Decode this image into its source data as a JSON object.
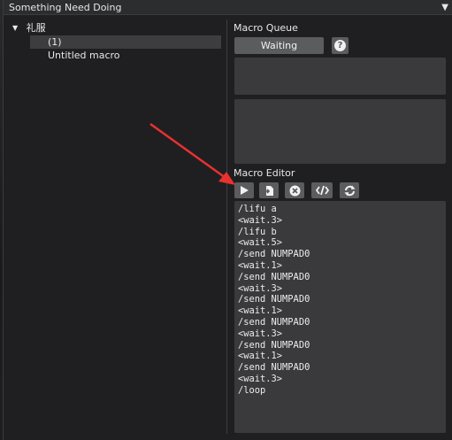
{
  "window": {
    "title": "Something Need Doing",
    "collapse_icon": "triangle-down-icon"
  },
  "tree": {
    "folder_label": "礼服",
    "items": [
      {
        "label": "(1)",
        "selected": true
      },
      {
        "label": "Untitled macro",
        "selected": false
      }
    ]
  },
  "queue": {
    "title": "Macro Queue",
    "status_button": "Waiting",
    "help_icon": "?"
  },
  "editor": {
    "title": "Macro Editor",
    "toolbar": [
      "play-icon",
      "import-icon",
      "close-circle-icon",
      "code-icon",
      "refresh-icon"
    ],
    "lines": [
      "/lifu a",
      "<wait.3>",
      "/lifu b",
      "<wait.5>",
      "/send NUMPAD0",
      "<wait.1>",
      "/send NUMPAD0",
      "<wait.3>",
      "/send NUMPAD0",
      "<wait.1>",
      "/send NUMPAD0",
      "<wait.3>",
      "/send NUMPAD0",
      "<wait.1>",
      "/send NUMPAD0",
      "<wait.3>",
      "/loop"
    ]
  },
  "colors": {
    "annotation_arrow": "#e8322f",
    "panel_bg": "#3a3a3c",
    "button_bg": "#5b5c5e"
  }
}
